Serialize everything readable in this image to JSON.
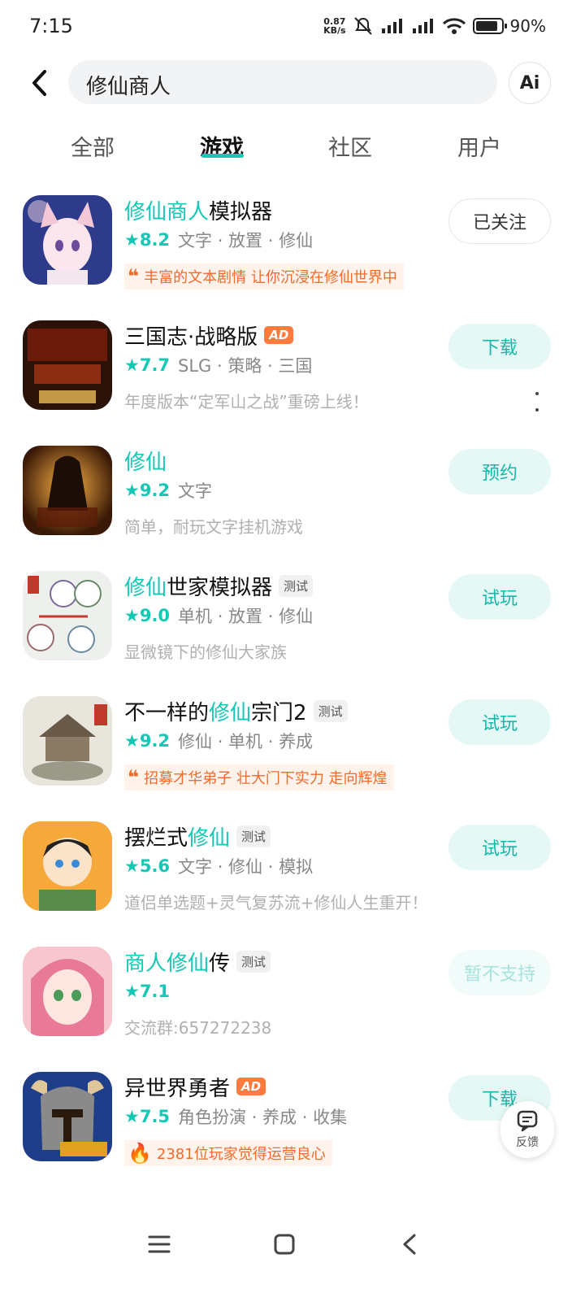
{
  "status_bar": {
    "time": "7:15",
    "net_speed_value": "0.87",
    "net_speed_unit": "KB/s",
    "battery": "90%"
  },
  "search": {
    "query": "修仙商人",
    "ai_label": "Ai"
  },
  "tabs": [
    {
      "label": "全部",
      "active": false
    },
    {
      "label": "游戏",
      "active": true
    },
    {
      "label": "社区",
      "active": false
    },
    {
      "label": "用户",
      "active": false
    }
  ],
  "games": [
    {
      "title_hl": "修仙商人",
      "title_rest": "模拟器",
      "title_prefix": "",
      "title_suffix": "",
      "badge": "",
      "rating": "8.2",
      "tags": "文字 · 放置 · 修仙",
      "desc": "",
      "quote": "丰富的文本剧情 让你沉浸在修仙世界中",
      "button": "已关注"
    },
    {
      "title_hl": "",
      "title_rest": "三国志·战略版",
      "title_prefix": "",
      "title_suffix": "",
      "badge": "AD",
      "rating": "7.7",
      "tags": "SLG · 策略 · 三国",
      "desc": "年度版本“定军山之战”重磅上线！",
      "quote": "",
      "button": "下载"
    },
    {
      "title_hl": "修仙",
      "title_rest": "",
      "title_prefix": "",
      "title_suffix": "",
      "badge": "",
      "rating": "9.2",
      "tags": "文字",
      "desc": "简单，耐玩文字挂机游戏",
      "quote": "",
      "button": "预约"
    },
    {
      "title_hl": "修仙",
      "title_rest": "世家模拟器",
      "title_prefix": "",
      "title_suffix": "",
      "badge": "测试",
      "rating": "9.0",
      "tags": "单机 · 放置 · 修仙",
      "desc": "显微镜下的修仙大家族",
      "quote": "",
      "button": "试玩"
    },
    {
      "title_prefix": "不一样的",
      "title_hl": "修仙",
      "title_suffix": "宗门2",
      "title_rest": "",
      "badge": "测试",
      "rating": "9.2",
      "tags": "修仙 · 单机 · 养成",
      "desc": "",
      "quote": "招募才华弟子 壮大门下实力 走向辉煌",
      "button": "试玩"
    },
    {
      "title_prefix": "摆烂式",
      "title_hl": "修仙",
      "title_suffix": "",
      "title_rest": "",
      "badge": "测试",
      "rating": "5.6",
      "tags": "文字 · 修仙 · 模拟",
      "desc": "道侣单选题+灵气复苏流+修仙人生重开！",
      "quote": "",
      "button": "试玩"
    },
    {
      "title_hl": "商人修仙",
      "title_rest": "传",
      "title_prefix": "",
      "title_suffix": "",
      "badge": "测试",
      "rating": "7.1",
      "tags": "",
      "desc": "交流群:657272238",
      "quote": "",
      "button": "暂不支持"
    },
    {
      "title_hl": "",
      "title_rest": "异世界勇者",
      "title_prefix": "",
      "title_suffix": "",
      "badge": "AD",
      "rating": "7.5",
      "tags": "角色扮演 · 养成 · 收集",
      "desc": "",
      "quote": "2381位玩家觉得运营良心",
      "button": "下载"
    }
  ],
  "feedback_label": "反馈",
  "colors": {
    "accent": "#14c8b6",
    "orange": "#f26b2a",
    "ad": "#ff7a3d"
  }
}
